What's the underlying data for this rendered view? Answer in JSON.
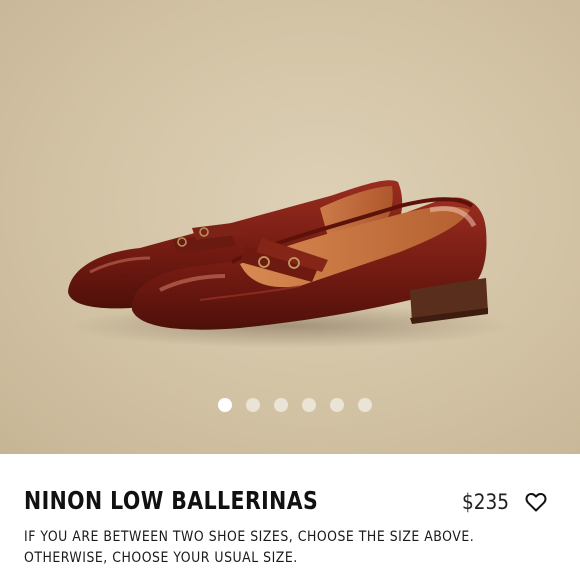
{
  "product": {
    "name": "NINON LOW BALLERINAS",
    "price": "$235",
    "description": "IF YOU ARE BETWEEN TWO SHOE SIZES, CHOOSE THE SIZE ABOVE. OTHERWISE, CHOOSE YOUR USUAL SIZE.",
    "favorite_icon": "heart-outline-icon"
  },
  "gallery": {
    "image_count": 6,
    "active_index": 0
  },
  "colors": {
    "background": "#d3c3a5",
    "shoe": "#7a1f14",
    "heel": "#5a2e1c",
    "lining": "#c2703c"
  }
}
